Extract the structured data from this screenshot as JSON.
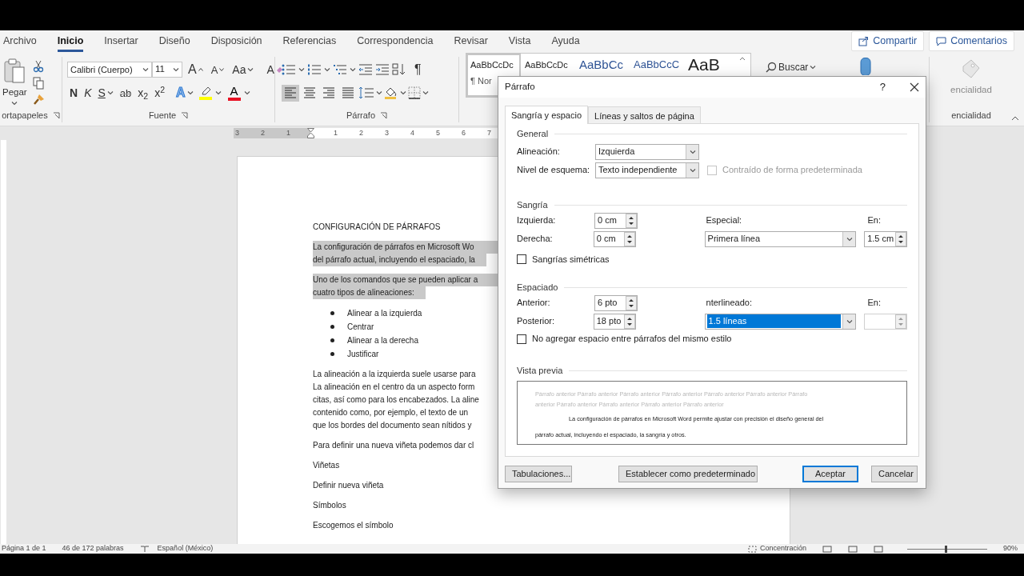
{
  "menu_tabs": [
    {
      "label": "Archivo",
      "selected": false
    },
    {
      "label": "Inicio",
      "selected": true
    },
    {
      "label": "Insertar",
      "selected": false
    },
    {
      "label": "Diseño",
      "selected": false
    },
    {
      "label": "Disposición",
      "selected": false
    },
    {
      "label": "Referencias",
      "selected": false
    },
    {
      "label": "Correspondencia",
      "selected": false
    },
    {
      "label": "Revisar",
      "selected": false
    },
    {
      "label": "Vista",
      "selected": false
    },
    {
      "label": "Ayuda",
      "selected": false
    }
  ],
  "share_button": "Compartir",
  "comments_button": "Comentarios",
  "ribbon": {
    "clipboard": {
      "paste_label": "Pegar",
      "group_label": "ortapapeles"
    },
    "font": {
      "font_name": "Calibri (Cuerpo)",
      "font_size": "11",
      "size_buttons": [
        {
          "label": "A",
          "kind": "grow"
        },
        {
          "label": "A",
          "kind": "shrink"
        }
      ],
      "case_label": "Aa",
      "clear_label": "A",
      "format_buttons": [
        {
          "label": "N",
          "kind": "bold",
          "has_menu": false
        },
        {
          "label": "K",
          "kind": "italic",
          "has_menu": false
        },
        {
          "label": "S",
          "kind": "underline",
          "has_menu": true
        },
        {
          "label": "ab",
          "kind": "strike",
          "has_menu": false
        },
        {
          "label": "x$_{2}$",
          "kind": "subscript",
          "has_menu": false
        },
        {
          "label": "x$^{2}$",
          "kind": "superscript",
          "has_menu": false
        }
      ],
      "effects_label": "A",
      "highlight": {
        "color": "#ffff00"
      },
      "font_color": {
        "label": "A",
        "color": "#e81123"
      },
      "group_label": "Fuente"
    },
    "paragraph": {
      "pilcrow": "¶",
      "alignments": [
        {
          "kind": "left",
          "selected": true
        },
        {
          "kind": "center",
          "selected": false
        },
        {
          "kind": "right",
          "selected": false
        },
        {
          "kind": "justify",
          "selected": false
        }
      ],
      "group_label": "Párrafo"
    },
    "styles": {
      "samples": [
        {
          "label": "AaBbCcDc",
          "kind": "normal",
          "selected": true
        },
        {
          "label": "AaBbCcDc",
          "kind": "plain",
          "selected": false
        },
        {
          "label": "AaBbCc",
          "kind": "heading1",
          "selected": false
        },
        {
          "label": "AaBbCcC",
          "kind": "heading2",
          "selected": false
        },
        {
          "label": "AaB",
          "kind": "title",
          "selected": false
        }
      ],
      "first_name": "¶ Nor"
    },
    "search_label": "Buscar",
    "sensitivity": {
      "label": "encialidad",
      "group_label": "encialidad"
    }
  },
  "ruler": {
    "labels": [
      "3",
      "2",
      "1",
      "1",
      "2",
      "3",
      "4",
      "5",
      "6",
      "7"
    ]
  },
  "document": {
    "blocks": [
      {
        "kind": "heading",
        "lines": [
          "CONFIGURACIÓN DE PÁRRAFOS"
        ],
        "highlighted": false
      },
      {
        "kind": "paragraph",
        "lines": [
          "La configuración de párrafos en Microsoft Wo",
          "del párrafo actual, incluyendo el espaciado, la"
        ],
        "highlighted": true
      },
      {
        "kind": "paragraph",
        "lines": [
          "Uno de los comandos que se pueden aplicar a",
          "cuatro tipos de alineaciones:"
        ],
        "highlighted": true
      },
      {
        "kind": "bullets",
        "lines": [
          "Alinear a la izquierda",
          "Centrar",
          "Alinear a la derecha",
          "Justificar"
        ],
        "highlighted": false
      },
      {
        "kind": "paragraph",
        "lines": [
          "La alineación a la izquierda suele usarse para",
          "La alineación en el centro da un aspecto form",
          "citas, así como para los encabezados. La aline",
          "contenido como, por ejemplo, el texto de un",
          "que los bordes del documento sean nítidos y"
        ],
        "highlighted": false
      },
      {
        "kind": "paragraph",
        "lines": [
          "Para definir una nueva viñeta podemos dar cl"
        ],
        "highlighted": false
      },
      {
        "kind": "paragraph",
        "lines": [
          "Viñetas"
        ],
        "highlighted": false
      },
      {
        "kind": "paragraph",
        "lines": [
          "Definir nueva viñeta"
        ],
        "highlighted": false
      },
      {
        "kind": "paragraph",
        "lines": [
          "Símbolos"
        ],
        "highlighted": false
      },
      {
        "kind": "paragraph",
        "lines": [
          "Escogemos el símbolo"
        ],
        "highlighted": false
      }
    ]
  },
  "dialog": {
    "title": "Párrafo",
    "help": "?",
    "tabs": [
      {
        "label": "Sangría y espacio",
        "selected": true
      },
      {
        "label": "Líneas y saltos de página",
        "selected": false
      }
    ],
    "general": {
      "heading": "General",
      "alignment": {
        "label": "Alineación:",
        "value": "Izquierda"
      },
      "outline_level": {
        "label": "Nivel de esquema:",
        "value": "Texto independiente"
      },
      "collapsed": {
        "label": "Contraído de forma predeterminada",
        "checked": false,
        "disabled": true
      }
    },
    "indentation": {
      "heading": "Sangría",
      "left": {
        "label": "Izquierda:",
        "value": "0 cm"
      },
      "right": {
        "label": "Derecha:",
        "value": "0 cm"
      },
      "special": {
        "label": "Especial:",
        "value": "Primera línea"
      },
      "by": {
        "label": "En:",
        "value": "1.5 cm",
        "disabled": false
      },
      "mirror": {
        "label": "Sangrías simétricas",
        "checked": false,
        "disabled": false
      }
    },
    "spacing": {
      "heading": "Espaciado",
      "before": {
        "label": "Anterior:",
        "value": "6 pto"
      },
      "after": {
        "label": "Posterior:",
        "value": "18 pto"
      },
      "line_spacing": {
        "label": "nterlineado:",
        "value": "1.5 líneas",
        "highlighted": true
      },
      "at": {
        "label": "En:",
        "disabled": true
      },
      "no_space": {
        "label": "No agregar espacio entre párrafos del mismo estilo",
        "checked": false,
        "disabled": false
      }
    },
    "preview": {
      "heading": "Vista previa",
      "previous_lines": [
        "Párrafo anterior Párrafo anterior Párrafo anterior Párrafo anterior Párrafo anterior Párrafo anterior Párrafo",
        "anterior Párrafo anterior Párrafo anterior Párrafo anterior Párrafo anterior"
      ],
      "sample_lines": [
        "La configuración de párrafos en Microsoft Word permite ajustar con precisión el diseño general del",
        "párrafo actual, incluyendo el espaciado, la sangría y otros."
      ]
    },
    "buttons": [
      {
        "label": "Tabulaciones...",
        "default": false
      },
      {
        "label": "Establecer como predeterminado",
        "default": false
      },
      {
        "label": "Aceptar",
        "default": true
      },
      {
        "label": "Cancelar",
        "default": false
      }
    ]
  },
  "status_bar": {
    "page": "Página 1 de 1",
    "words": "46 de 172 palabras",
    "language": "Español (México)",
    "focus": "Concentración",
    "zoom": "90%",
    "zoom_slider": {
      "level": 0.47
    }
  }
}
